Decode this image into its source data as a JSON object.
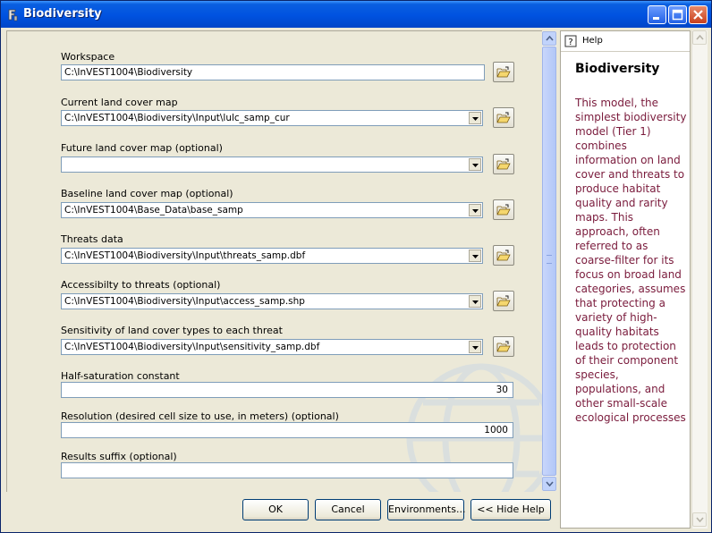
{
  "window": {
    "title": "Biodiversity"
  },
  "fields": [
    {
      "label": "Workspace",
      "value": "C:\\InVEST1004\\Biodiversity"
    },
    {
      "label": "Current land cover map",
      "value": "C:\\InVEST1004\\Biodiversity\\Input\\lulc_samp_cur"
    },
    {
      "label": "Future land cover map (optional)",
      "value": ""
    },
    {
      "label": "Baseline land cover map  (optional)",
      "value": "C:\\InVEST1004\\Base_Data\\base_samp"
    },
    {
      "label": "Threats data",
      "value": "C:\\InVEST1004\\Biodiversity\\Input\\threats_samp.dbf"
    },
    {
      "label": "Accessibilty to threats (optional)",
      "value": "C:\\InVEST1004\\Biodiversity\\Input\\access_samp.shp"
    },
    {
      "label": "Sensitivity of land cover types to each threat",
      "value": "C:\\InVEST1004\\Biodiversity\\Input\\sensitivity_samp.dbf"
    },
    {
      "label": "Half-saturation constant",
      "value": "30"
    },
    {
      "label": "Resolution (desired cell size to use, in meters) (optional)",
      "value": "1000"
    },
    {
      "label": "Results suffix (optional)",
      "value": ""
    }
  ],
  "buttons": {
    "ok": "OK",
    "cancel": "Cancel",
    "environments": "Environments...",
    "hide_help": "<< Hide Help"
  },
  "help": {
    "tab_label": "Help",
    "title": "Biodiversity",
    "body": "This model, the simplest biodiversity model (Tier 1) combines information on land cover and threats to produce habitat quality and rarity maps. This approach, often referred to as coarse-filter for its focus on broad land categories, assumes that protecting a variety of high-quality habitats leads to protection of their component species, populations, and other small-scale ecological processes"
  },
  "colors": {
    "help_text": "#7a1b3c",
    "titlebar": "#0052e0"
  },
  "icons": {
    "app": "tool-icon",
    "browse": "open-folder-icon",
    "help": "help-icon",
    "minimize": "minimize-icon",
    "maximize": "maximize-icon",
    "close": "close-icon"
  }
}
